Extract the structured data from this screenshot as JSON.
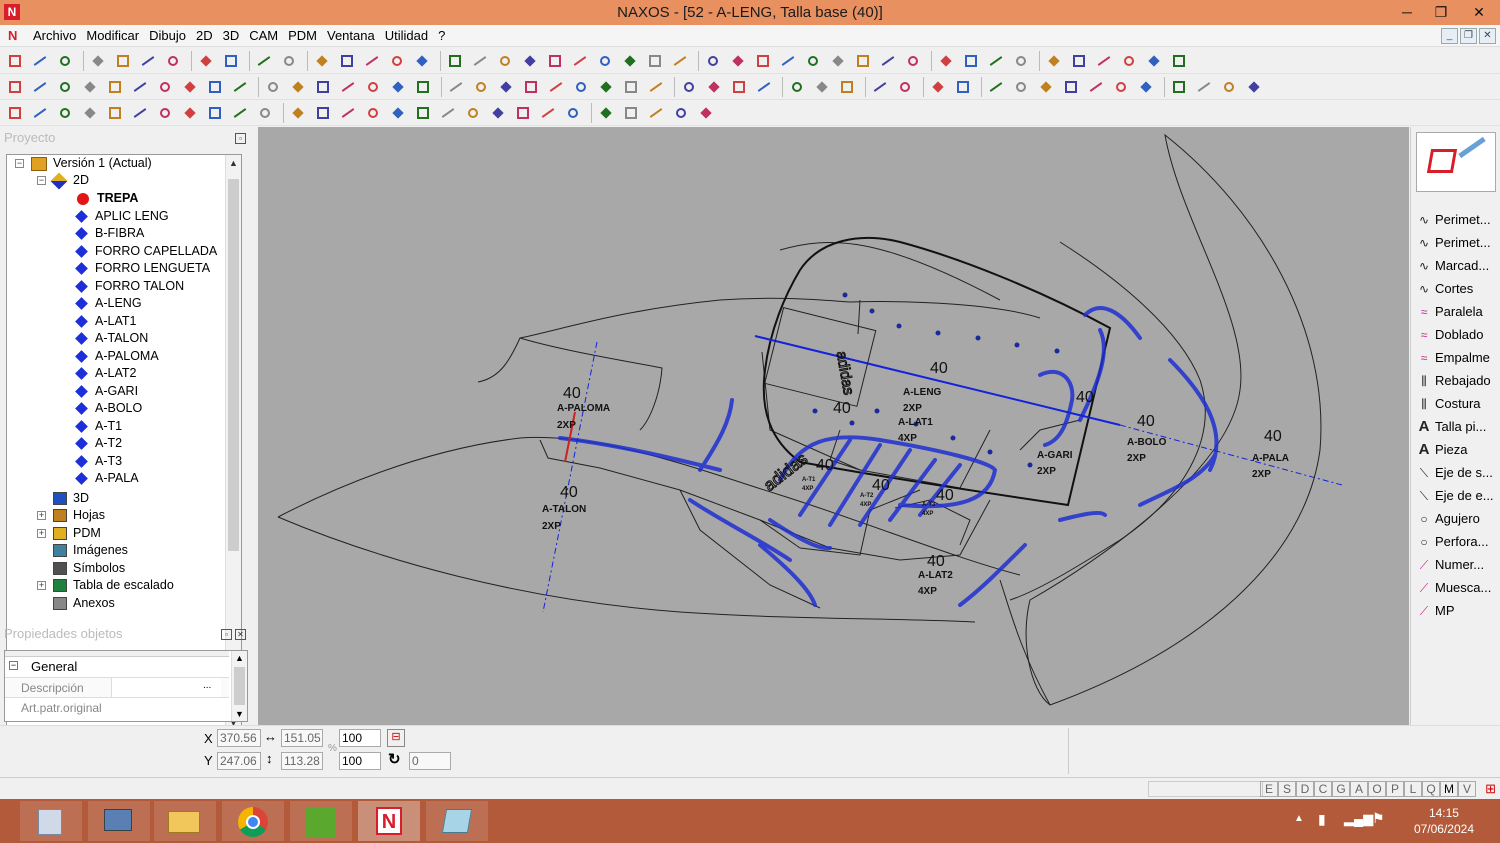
{
  "window": {
    "title": "NAXOS - [52 - A-LENG, Talla base (40)]",
    "logo": "N",
    "minimize": "─",
    "restore": "❐",
    "close": "✕"
  },
  "menu": {
    "logo": "N",
    "items": [
      "Archivo",
      "Modificar",
      "Dibujo",
      "2D",
      "3D",
      "CAM",
      "PDM",
      "Ventana",
      "Utilidad",
      "?"
    ]
  },
  "project": {
    "header": "Proyecto",
    "version": "Versión 1 (Actual)",
    "folder2d": "2D",
    "pieces": [
      "TREPA",
      "APLIC LENG",
      "B-FIBRA",
      "FORRO CAPELLADA",
      "FORRO LENGUETA",
      "FORRO TALON",
      "A-LENG",
      "A-LAT1",
      "A-TALON",
      "A-PALOMA",
      "A-LAT2",
      "A-GARI",
      "A-BOLO",
      "A-T1",
      "A-T2",
      "A-T3",
      "A-PALA"
    ],
    "others": [
      "3D",
      "Hojas",
      "PDM",
      "Imágenes",
      "Símbolos",
      "Tabla de escalado",
      "Anexos"
    ]
  },
  "properties": {
    "header": "Propiedades objetos",
    "group": "General",
    "rows": [
      "Descripción",
      "Art.patr.original"
    ]
  },
  "coords": {
    "x_label": "X",
    "y_label": "Y",
    "x": "370.56",
    "y": "247.06",
    "w": "151.05",
    "h": "113.28",
    "sx": "100",
    "sy": "100",
    "angle": "0",
    "pct": "%"
  },
  "right_tools": [
    {
      "icon": "perimeter-icon",
      "label": "Perimet..."
    },
    {
      "icon": "perimeter-icon",
      "label": "Perimet..."
    },
    {
      "icon": "mark-icon",
      "label": "Marcad..."
    },
    {
      "icon": "cut-icon",
      "label": "Cortes"
    },
    {
      "icon": "parallel-icon",
      "label": "Paralela"
    },
    {
      "icon": "fold-icon",
      "label": "Doblado"
    },
    {
      "icon": "join-icon",
      "label": "Empalme"
    },
    {
      "icon": "skive-icon",
      "label": "Rebajado"
    },
    {
      "icon": "stitch-icon",
      "label": "Costura"
    },
    {
      "icon": "text-icon",
      "label": "Talla pi..."
    },
    {
      "icon": "text-icon",
      "label": "Pieza"
    },
    {
      "icon": "axis-icon",
      "label": "Eje de s..."
    },
    {
      "icon": "axis-icon",
      "label": "Eje de e..."
    },
    {
      "icon": "hole-icon",
      "label": "Agujero"
    },
    {
      "icon": "hole-icon",
      "label": "Perfora..."
    },
    {
      "icon": "number-icon",
      "label": "Numer..."
    },
    {
      "icon": "notch-icon",
      "label": "Muesca..."
    },
    {
      "icon": "mp-icon",
      "label": "MP"
    }
  ],
  "status": {
    "letters": [
      "E",
      "S",
      "D",
      "C",
      "G",
      "A",
      "O",
      "P",
      "L",
      "Q",
      "M",
      "V"
    ]
  },
  "taskbar": {
    "time": "14:15",
    "date": "07/06/2024"
  },
  "drawing": {
    "labels": [
      {
        "size": "40",
        "name": "A-PALOMA",
        "qty": "2XP"
      },
      {
        "size": "40",
        "name": "A-TALON",
        "qty": "2XP"
      },
      {
        "size": "40",
        "name": "A-LENG",
        "qty": "2XP"
      },
      {
        "size": "40",
        "name": "A-LAT1",
        "qty": "4XP"
      },
      {
        "size": "40",
        "name": "A-GARI",
        "qty": "2XP"
      },
      {
        "size": "40",
        "name": "A-BOLO",
        "qty": "2XP"
      },
      {
        "size": "40",
        "name": "A-PALA",
        "qty": "2XP"
      },
      {
        "size": "40",
        "name": "A-LAT2",
        "qty": "4XP"
      }
    ],
    "small_labels": [
      "A-T1",
      "A-T2",
      "A-T3"
    ],
    "small_qty": "4XP",
    "extra_sizes": [
      "40",
      "40",
      "40",
      "40",
      "40"
    ],
    "brand": "adidas"
  }
}
